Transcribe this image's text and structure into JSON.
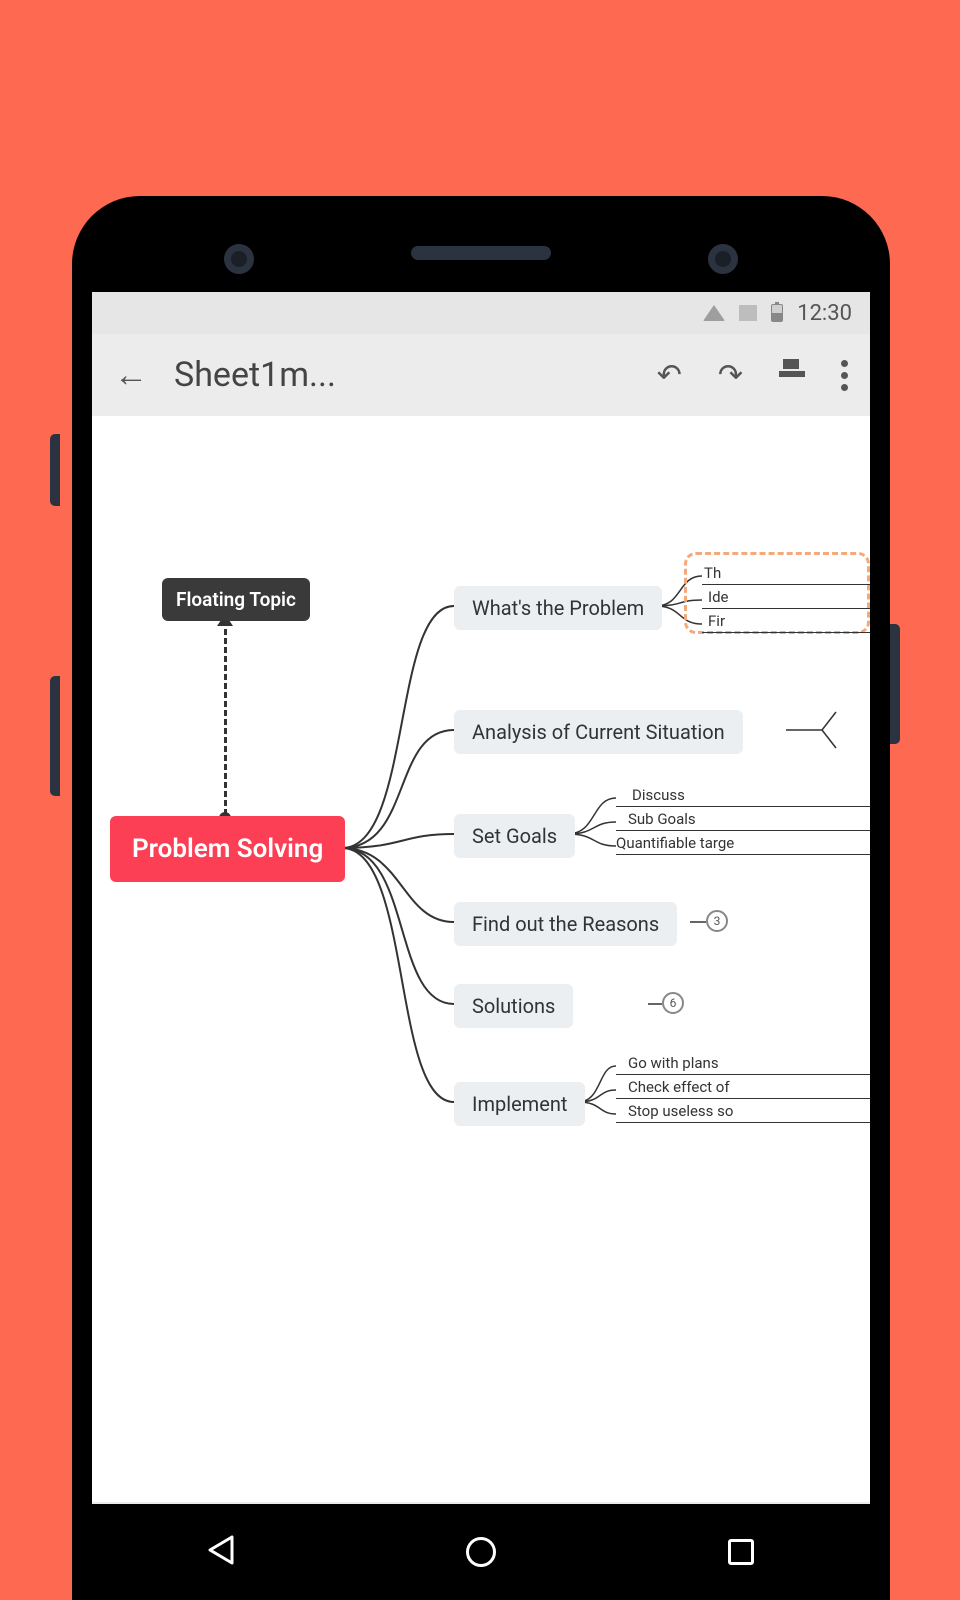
{
  "statusbar": {
    "time": "12:30"
  },
  "appbar": {
    "title": "Sheet1m..."
  },
  "mindmap": {
    "root": "Problem Solving",
    "floating": "Floating Topic",
    "children": [
      {
        "label": "What's the Problem",
        "leaves": [
          "Th",
          "Ide",
          "Fir"
        ]
      },
      {
        "label": "Analysis of Current Situation"
      },
      {
        "label": "Set Goals",
        "leaves": [
          "Discuss",
          "Sub Goals",
          "Quantifiable targe"
        ]
      },
      {
        "label": "Find out the Reasons",
        "count": "3"
      },
      {
        "label": "Solutions",
        "count": "6"
      },
      {
        "label": "Implement",
        "leaves": [
          "Go with plans",
          "Check effect of",
          "Stop useless so"
        ]
      }
    ]
  }
}
